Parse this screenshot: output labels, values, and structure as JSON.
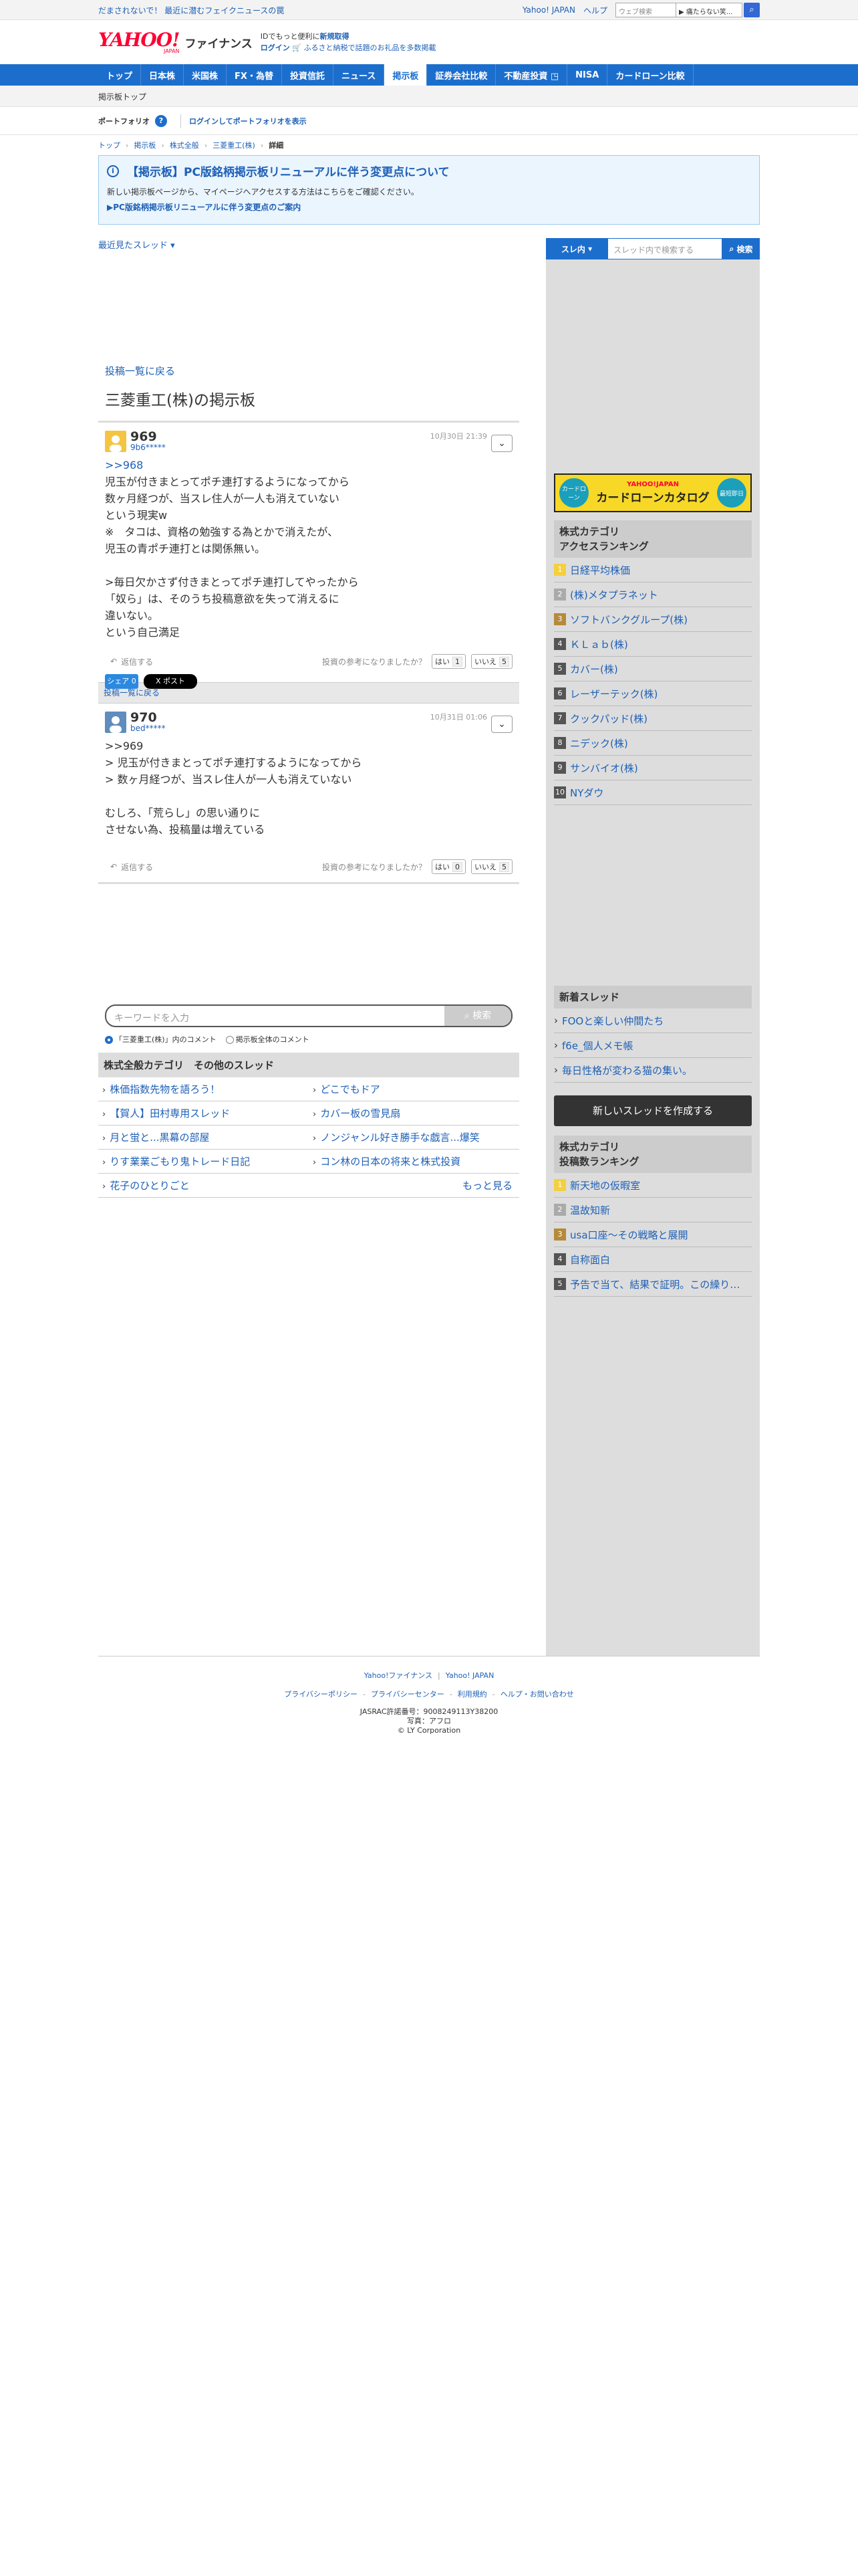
{
  "topbar": {
    "promo": "だまされないで！ 最近に潜むフェイクニュースの罠",
    "yahoo_japan": "Yahoo! JAPAN",
    "help": "ヘルプ",
    "search_placeholder": "ウェブ検索",
    "search_select": "▶ 痛たらない笑...",
    "search_icon": "search-icon"
  },
  "header": {
    "logo_main": "YAHOO!",
    "logo_sub": "JAPAN",
    "logo_fin": "ファイナンス",
    "tagline": "IDでもっと便利に",
    "signup": "新規取得",
    "login": "ログイン",
    "furusato": "ふるさと納税で話題のお礼品を多数掲載"
  },
  "gnav": [
    "トップ",
    "日本株",
    "米国株",
    "FX・為替",
    "投資信託",
    "ニュース",
    "掲示板",
    "証券会社比較",
    "不動産投資 ◳",
    "NISA",
    "カードローン比較"
  ],
  "gnav_active": "掲示板",
  "subbar": {
    "label": "掲示板トップ"
  },
  "portfolio": {
    "title": "ポートフォリオ",
    "help": "?",
    "login_link": "ログインしてポートフォリオを表示"
  },
  "breadcrumb": [
    "トップ",
    "掲示板",
    "株式全般",
    "三菱重工(株)",
    "詳細"
  ],
  "notice": {
    "title": "【掲示板】PC版銘柄掲示板リニューアルに伴う変更点について",
    "text": "新しい掲示板ページから、マイページへアクセスする方法はこちらをご確認ください。",
    "link": "▶PC版銘柄掲示板リニューアルに伴う変更点のご案内"
  },
  "recent_threads": "最近見たスレッド",
  "back_to_list": "投稿一覧に戻る",
  "board_title": "三菱重工(株)の掲示板",
  "comments": [
    {
      "no": "969",
      "user": "9b6*****",
      "date": "10月30日 21:39",
      "reply_link": ">>968",
      "body": "児玉が付きまとってポチ連打するようになってから\n数ヶ月経つが、当スレ住人が一人も消えていない\nという現実w\n※　タコは、資格の勉強する為とかで消えたが、\n児玉の青ポチ連打とは関係無い。\n\n>毎日欠かさず付きまとってポチ連打してやったから\n「奴ら」は、そのうち投稿意欲を失って消えるに\n違いない。\nという自己満足",
      "reply": "返信する",
      "vote_q": "投資の参考になりましたか？",
      "yes": "はい",
      "yes_n": "1",
      "no_label": "いいえ",
      "no_n": "5"
    },
    {
      "no": "970",
      "user": "bed*****",
      "date": "10月31日 01:06",
      "reply_link": "",
      "body": ">>969\n> 児玉が付きまとってポチ連打するようになってから\n> 数ヶ月経つが、当スレ住人が一人も消えていない\n\nむしろ、「荒らし」の思い通りに\nさせない為、投稿量は増えている",
      "reply": "返信する",
      "vote_q": "投資の参考になりましたか？",
      "yes": "はい",
      "yes_n": "0",
      "no_label": "いいえ",
      "no_n": "5"
    }
  ],
  "share": {
    "share_a": "シェア 0",
    "share_b": "X ポスト"
  },
  "keyword": {
    "placeholder": "キーワードを入力",
    "button": "検索",
    "radio1": "「三菱重工(株)」内のコメント",
    "radio2": "掲示板全体のコメント"
  },
  "other": {
    "title": "株式全般カテゴリ　その他のスレッド",
    "items": [
      [
        "株価指数先物を語ろう！",
        "どこでもドア"
      ],
      [
        "【賀人】田村専用スレッド",
        "カバー板の雪見扇"
      ],
      [
        "月と蛍と...黒幕の部屋",
        "ノンジャンル好き勝手な戯言...爆笑"
      ],
      [
        "りす業業ごもり鬼トレード日記",
        "コン林の日本の将来と株式投資"
      ],
      [
        "花子のひとりごと",
        "もっと見る"
      ]
    ]
  },
  "side": {
    "search_btn": "スレ内",
    "search_placeholder": "スレッド内で検索する",
    "search_go": "検索",
    "banner_left": "カードローン",
    "banner_brand": "YAHOO!JAPAN",
    "banner_title": "カードローンカタログ",
    "banner_right": "最短即日",
    "rank1_title": "株式カテゴリ\nアクセスランキング",
    "rank1": [
      "日経平均株価",
      "(株)メタプラネット",
      "ソフトバンクグループ(株)",
      "ＫＬａｂ(株)",
      "カバー(株)",
      "レーザーテック(株)",
      "クックパッド(株)",
      "ニデック(株)",
      "サンバイオ(株)",
      "NYダウ"
    ],
    "newthread_title": "新着スレッド",
    "newthread": [
      "FOOと楽しい仲間たち",
      "f6e_個人メモ帳",
      "毎日性格が変わる猫の集い。"
    ],
    "new_button": "新しいスレッドを作成する",
    "rank2_title": "株式カテゴリ\n投稿数ランキング",
    "rank2": [
      "新天地の仮暇室",
      "温故知新",
      "usa口座～その戦略と展開",
      "自称面白",
      "予告で当て、結果で証明。この繰り…"
    ]
  },
  "footer": {
    "links1": [
      "Yahoo!ファイナンス",
      "Yahoo! JAPAN"
    ],
    "links2": [
      "プライバシーポリシー",
      "プライバシーセンター",
      "利用規約",
      "ヘルプ・お問い合わせ"
    ],
    "jasrac": "JASRAC許諾番号：9008249113Y38200",
    "photo": "写真：アフロ",
    "copy": "© LY Corporation"
  }
}
